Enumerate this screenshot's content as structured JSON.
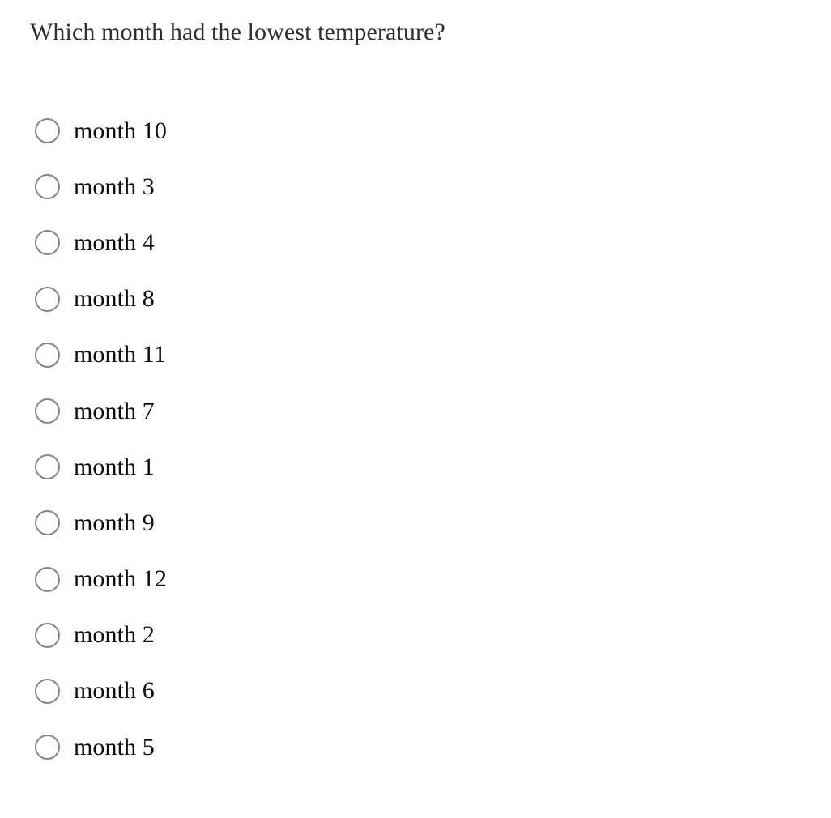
{
  "question": {
    "text": "Which month had the lowest temperature?"
  },
  "options": [
    {
      "label": "month 10",
      "value": "month 10",
      "selected": false
    },
    {
      "label": "month 3",
      "value": "month 3",
      "selected": false
    },
    {
      "label": "month 4",
      "value": "month 4",
      "selected": false
    },
    {
      "label": "month 8",
      "value": "month 8",
      "selected": false
    },
    {
      "label": "month 11",
      "value": "month 11",
      "selected": false
    },
    {
      "label": "month 7",
      "value": "month 7",
      "selected": false
    },
    {
      "label": "month 1",
      "value": "month 1",
      "selected": false
    },
    {
      "label": "month 9",
      "value": "month 9",
      "selected": false
    },
    {
      "label": "month 12",
      "value": "month 12",
      "selected": false
    },
    {
      "label": "month 2",
      "value": "month 2",
      "selected": false
    },
    {
      "label": "month 6",
      "value": "month 6",
      "selected": false
    },
    {
      "label": "month 5",
      "value": "month 5",
      "selected": false
    }
  ],
  "colors": {
    "background": "#ffffff",
    "question_text": "#2f2f2f",
    "option_text": "#0d0d0d",
    "radio_border": "#878787"
  }
}
